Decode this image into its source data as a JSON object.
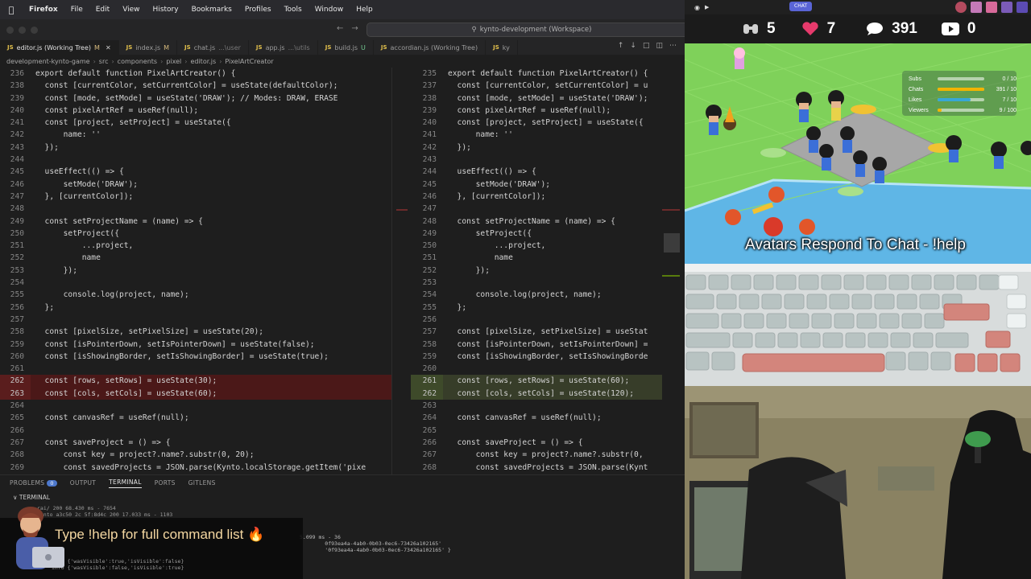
{
  "menubar": {
    "app": "Firefox",
    "items": [
      "File",
      "Edit",
      "View",
      "History",
      "Bookmarks",
      "Profiles",
      "Tools",
      "Window",
      "Help"
    ]
  },
  "window": {
    "command_center": "kynto-development (Workspace)"
  },
  "tabs": [
    {
      "icon": "JS",
      "label": "editor.js (Working Tree)",
      "mod": "M",
      "active": true
    },
    {
      "icon": "JS",
      "label": "index.js",
      "mod": "M",
      "active": false
    },
    {
      "icon": "JS",
      "label": "chat.js",
      "detail": "...\\user",
      "mod": "",
      "active": false
    },
    {
      "icon": "JS",
      "label": "app.js",
      "detail": "...\\utils",
      "mod": "",
      "active": false
    },
    {
      "icon": "JS",
      "label": "build.js",
      "mod": "U",
      "active": false
    },
    {
      "icon": "JS",
      "label": "accordian.js (Working Tree)",
      "mod": "",
      "active": false
    },
    {
      "icon": "JS",
      "label": "ky",
      "mod": "",
      "active": false
    }
  ],
  "breadcrumb": [
    "development-kynto-game",
    "src",
    "components",
    "pixel",
    "editor.js",
    "PixelArtCreator"
  ],
  "editor_left": {
    "lines": [
      {
        "n": "236",
        "t": "export default function PixelArtCreator() {",
        "s": ""
      },
      {
        "n": "238",
        "t": "  const [currentColor, setCurrentColor] = useState(defaultColor);",
        "s": ""
      },
      {
        "n": "239",
        "t": "  const [mode, setMode] = useState('DRAW'); // Modes: DRAW, ERASE",
        "s": ""
      },
      {
        "n": "240",
        "t": "  const pixelArtRef = useRef(null);",
        "s": ""
      },
      {
        "n": "241",
        "t": "  const [project, setProject] = useState({",
        "s": ""
      },
      {
        "n": "242",
        "t": "      name: ''",
        "s": ""
      },
      {
        "n": "243",
        "t": "  });",
        "s": ""
      },
      {
        "n": "244",
        "t": "",
        "s": ""
      },
      {
        "n": "245",
        "t": "  useEffect(() => {",
        "s": ""
      },
      {
        "n": "246",
        "t": "      setMode('DRAW');",
        "s": ""
      },
      {
        "n": "247",
        "t": "  }, [currentColor]);",
        "s": ""
      },
      {
        "n": "248",
        "t": "",
        "s": ""
      },
      {
        "n": "249",
        "t": "  const setProjectName = (name) => {",
        "s": ""
      },
      {
        "n": "250",
        "t": "      setProject({",
        "s": ""
      },
      {
        "n": "251",
        "t": "          ...project,",
        "s": ""
      },
      {
        "n": "252",
        "t": "          name",
        "s": ""
      },
      {
        "n": "253",
        "t": "      });",
        "s": ""
      },
      {
        "n": "254",
        "t": "",
        "s": ""
      },
      {
        "n": "255",
        "t": "      console.log(project, name);",
        "s": ""
      },
      {
        "n": "256",
        "t": "  };",
        "s": ""
      },
      {
        "n": "257",
        "t": "",
        "s": ""
      },
      {
        "n": "258",
        "t": "  const [pixelSize, setPixelSize] = useState(20);",
        "s": ""
      },
      {
        "n": "259",
        "t": "  const [isPointerDown, setIsPointerDown] = useState(false);",
        "s": ""
      },
      {
        "n": "260",
        "t": "  const [isShowingBorder, setIsShowingBorder] = useState(true);",
        "s": ""
      },
      {
        "n": "261",
        "t": "",
        "s": ""
      },
      {
        "n": "262",
        "t": "  const [rows, setRows] = useState(30);",
        "s": "del"
      },
      {
        "n": "263",
        "t": "  const [cols, setCols] = useState(60);",
        "s": "del"
      },
      {
        "n": "264",
        "t": "",
        "s": ""
      },
      {
        "n": "265",
        "t": "  const canvasRef = useRef(null);",
        "s": ""
      },
      {
        "n": "266",
        "t": "",
        "s": ""
      },
      {
        "n": "267",
        "t": "  const saveProject = () => {",
        "s": ""
      },
      {
        "n": "268",
        "t": "      const key = project?.name?.substr(0, 20);",
        "s": ""
      },
      {
        "n": "269",
        "t": "      const savedProjects = JSON.parse(Kynto.localStorage.getItem('pixe",
        "s": ""
      }
    ]
  },
  "editor_right": {
    "lines": [
      {
        "n": "235",
        "t": "export default function PixelArtCreator() {",
        "s": ""
      },
      {
        "n": "237",
        "t": "  const [currentColor, setCurrentColor] = u",
        "s": ""
      },
      {
        "n": "238",
        "t": "  const [mode, setMode] = useState('DRAW');",
        "s": ""
      },
      {
        "n": "239",
        "t": "  const pixelArtRef = useRef(null);",
        "s": ""
      },
      {
        "n": "240",
        "t": "  const [project, setProject] = useState({",
        "s": ""
      },
      {
        "n": "241",
        "t": "      name: ''",
        "s": ""
      },
      {
        "n": "242",
        "t": "  });",
        "s": ""
      },
      {
        "n": "243",
        "t": "",
        "s": ""
      },
      {
        "n": "244",
        "t": "  useEffect(() => {",
        "s": ""
      },
      {
        "n": "245",
        "t": "      setMode('DRAW');",
        "s": ""
      },
      {
        "n": "246",
        "t": "  }, [currentColor]);",
        "s": ""
      },
      {
        "n": "247",
        "t": "",
        "s": ""
      },
      {
        "n": "248",
        "t": "  const setProjectName = (name) => {",
        "s": ""
      },
      {
        "n": "249",
        "t": "      setProject({",
        "s": ""
      },
      {
        "n": "250",
        "t": "          ...project,",
        "s": ""
      },
      {
        "n": "251",
        "t": "          name",
        "s": ""
      },
      {
        "n": "252",
        "t": "      });",
        "s": ""
      },
      {
        "n": "253",
        "t": "",
        "s": ""
      },
      {
        "n": "254",
        "t": "      console.log(project, name);",
        "s": ""
      },
      {
        "n": "255",
        "t": "  };",
        "s": ""
      },
      {
        "n": "256",
        "t": "",
        "s": ""
      },
      {
        "n": "257",
        "t": "  const [pixelSize, setPixelSize] = useStat",
        "s": ""
      },
      {
        "n": "258",
        "t": "  const [isPointerDown, setIsPointerDown] =",
        "s": ""
      },
      {
        "n": "259",
        "t": "  const [isShowingBorder, setIsShowingBorde",
        "s": ""
      },
      {
        "n": "260",
        "t": "",
        "s": ""
      },
      {
        "n": "261",
        "t": "  const [rows, setRows] = useState(60);",
        "s": "ins"
      },
      {
        "n": "262",
        "t": "  const [cols, setCols] = useState(120);",
        "s": "ins"
      },
      {
        "n": "263",
        "t": "",
        "s": ""
      },
      {
        "n": "264",
        "t": "  const canvasRef = useRef(null);",
        "s": ""
      },
      {
        "n": "265",
        "t": "",
        "s": ""
      },
      {
        "n": "266",
        "t": "  const saveProject = () => {",
        "s": ""
      },
      {
        "n": "267",
        "t": "      const key = project?.name?.substr(0,",
        "s": ""
      },
      {
        "n": "268",
        "t": "      const savedProjects = JSON.parse(Kynt",
        "s": ""
      }
    ]
  },
  "panel": {
    "tabs": [
      {
        "label": "PROBLEMS",
        "badge": "0",
        "active": false
      },
      {
        "label": "OUTPUT",
        "badge": "",
        "active": false
      },
      {
        "label": "TERMINAL",
        "badge": "",
        "active": true
      },
      {
        "label": "PORTS",
        "badge": "",
        "active": false
      },
      {
        "label": "GITLENS",
        "badge": "",
        "active": false
      }
    ],
    "terminal_title": "TERMINAL",
    "terminal_lines": [
      "rai/ 200 68.430 ms - 7654",
      "Kynto a3c50 2c 5f:8d4c 200 17.033 ms - 1103"
    ],
    "terminal_right": [
      "5.099 ms - 36",
      "        0f93ea4a-4ab0-0b03-0ec6-73426a102165'",
      "        '0f93ea4a-4ab0-0b03-0ec6-73426a102165' }"
    ],
    "terminal_bottom": [
      "info {'wasVisible':true,'isVisible':false}",
      "info {'wasVisible':false,'isVisible':true}"
    ],
    "help_banner": "Type !help for full command list 🔥"
  },
  "stream": {
    "top_pill": "CHAT",
    "stats": [
      {
        "icon": "binoculars-icon",
        "value": "5"
      },
      {
        "icon": "heart-icon",
        "value": "7"
      },
      {
        "icon": "chat-bubble-icon",
        "value": "391"
      },
      {
        "icon": "youtube-icon",
        "value": "0"
      }
    ],
    "goals": [
      {
        "label": "Subs",
        "value": "0 / 10",
        "fraction": 0.0,
        "color": "#f2b400"
      },
      {
        "label": "Chats",
        "value": "391 / 10",
        "fraction": 1.0,
        "color": "#f2b400"
      },
      {
        "label": "Likes",
        "value": "7 / 10",
        "fraction": 0.7,
        "color": "#38a7d6"
      },
      {
        "label": "Viewers",
        "value": "9 / 100",
        "fraction": 0.09,
        "color": "#f2b400"
      }
    ],
    "caption": "Avatars Respond To Chat - !help"
  }
}
